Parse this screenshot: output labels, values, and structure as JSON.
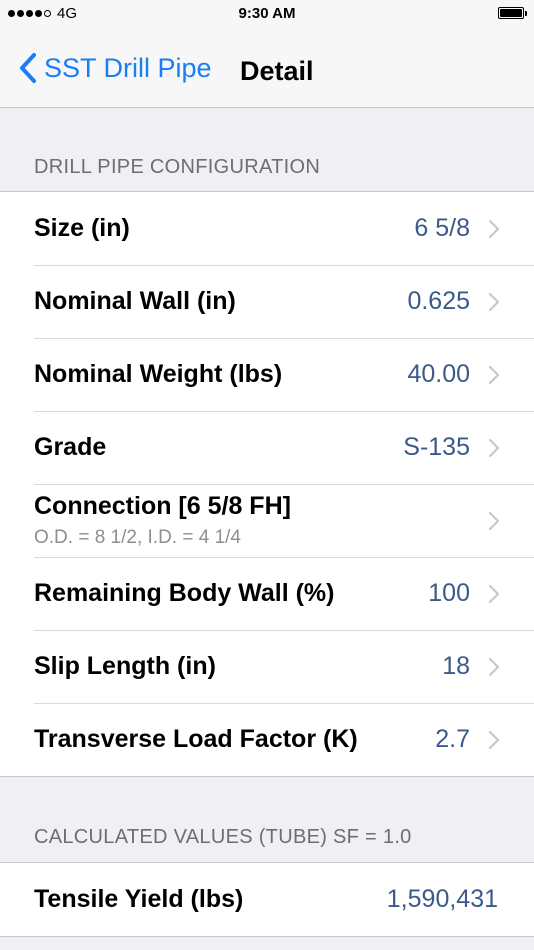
{
  "status_bar": {
    "carrier": "4G",
    "time": "9:30 AM"
  },
  "nav": {
    "back_label": "SST Drill Pipe",
    "title": "Detail"
  },
  "sections": [
    {
      "header": "DRILL PIPE CONFIGURATION",
      "rows": [
        {
          "label": "Size (in)",
          "value": "6 5/8"
        },
        {
          "label": "Nominal Wall (in)",
          "value": "0.625"
        },
        {
          "label": "Nominal Weight (lbs)",
          "value": "40.00"
        },
        {
          "label": "Grade",
          "value": "S-135"
        },
        {
          "label": "Connection [6 5/8 FH]",
          "subtitle": "O.D. = 8 1/2, I.D. = 4 1/4",
          "value": ""
        },
        {
          "label": "Remaining Body Wall (%)",
          "value": "100"
        },
        {
          "label": "Slip Length (in)",
          "value": "18"
        },
        {
          "label": "Transverse Load Factor (K)",
          "value": "2.7"
        }
      ]
    },
    {
      "header": "CALCULATED VALUES (TUBE) SF = 1.0",
      "rows": [
        {
          "label": "Tensile Yield (lbs)",
          "value": "1,590,431"
        }
      ]
    }
  ],
  "icons": {
    "back": "chevron-left-icon",
    "disclosure": "chevron-right-icon"
  },
  "colors": {
    "tint": "#1a7ef6",
    "value": "#3b5a8a",
    "background": "#efeff4"
  }
}
